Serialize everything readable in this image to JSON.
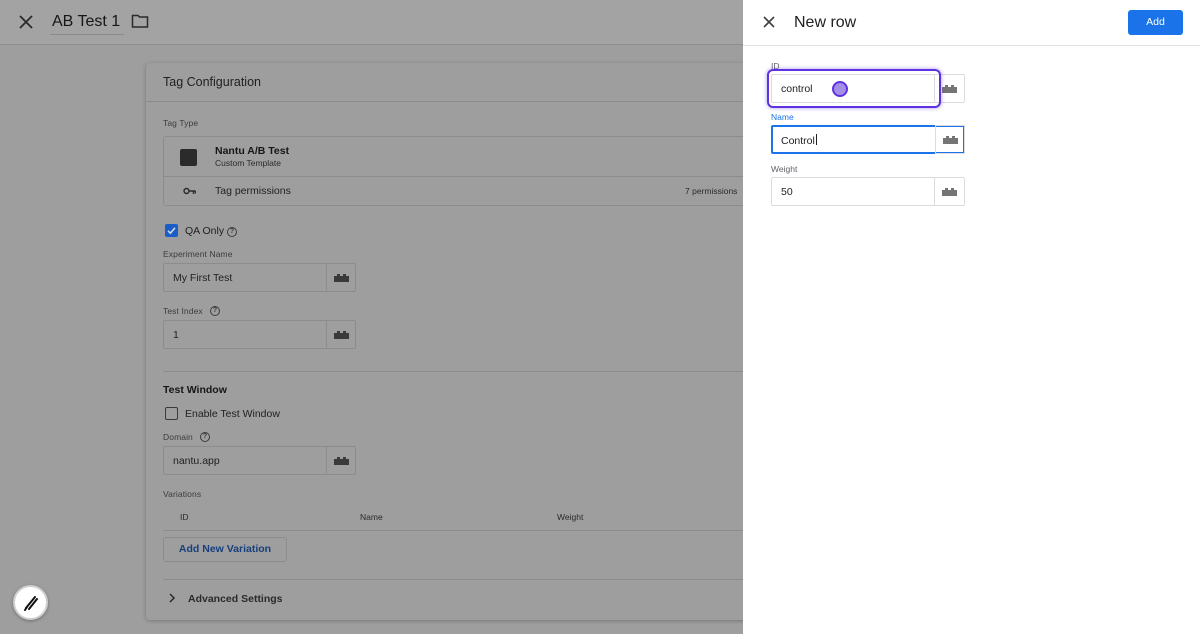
{
  "editor": {
    "title": "AB Test 1",
    "card_title": "Tag Configuration",
    "tag_type_label": "Tag Type",
    "template_name": "Nantu A/B Test",
    "template_sub": "Custom Template",
    "permissions_label": "Tag permissions",
    "permissions_count": "7 permissions",
    "qa_only_label": "QA Only",
    "qa_only_checked": true,
    "experiment_name_label": "Experiment Name",
    "experiment_name_value": "My First Test",
    "test_index_label": "Test Index",
    "test_index_value": "1",
    "test_window_title": "Test Window",
    "enable_window_label": "Enable Test Window",
    "enable_window_checked": false,
    "domain_label": "Domain",
    "domain_value": "nantu.app",
    "variations_label": "Variations",
    "variations_columns": [
      "ID",
      "Name",
      "Weight"
    ],
    "add_variation_label": "Add New Variation",
    "advanced_settings_label": "Advanced Settings"
  },
  "panel": {
    "title": "New row",
    "add_label": "Add",
    "fields": [
      {
        "label": "ID",
        "value": "control"
      },
      {
        "label": "Name",
        "value": "Control"
      },
      {
        "label": "Weight",
        "value": "50"
      }
    ]
  },
  "colors": {
    "accent": "#1a73e8",
    "highlight": "#5e32e0",
    "checkbox": "#1a5dc9"
  }
}
